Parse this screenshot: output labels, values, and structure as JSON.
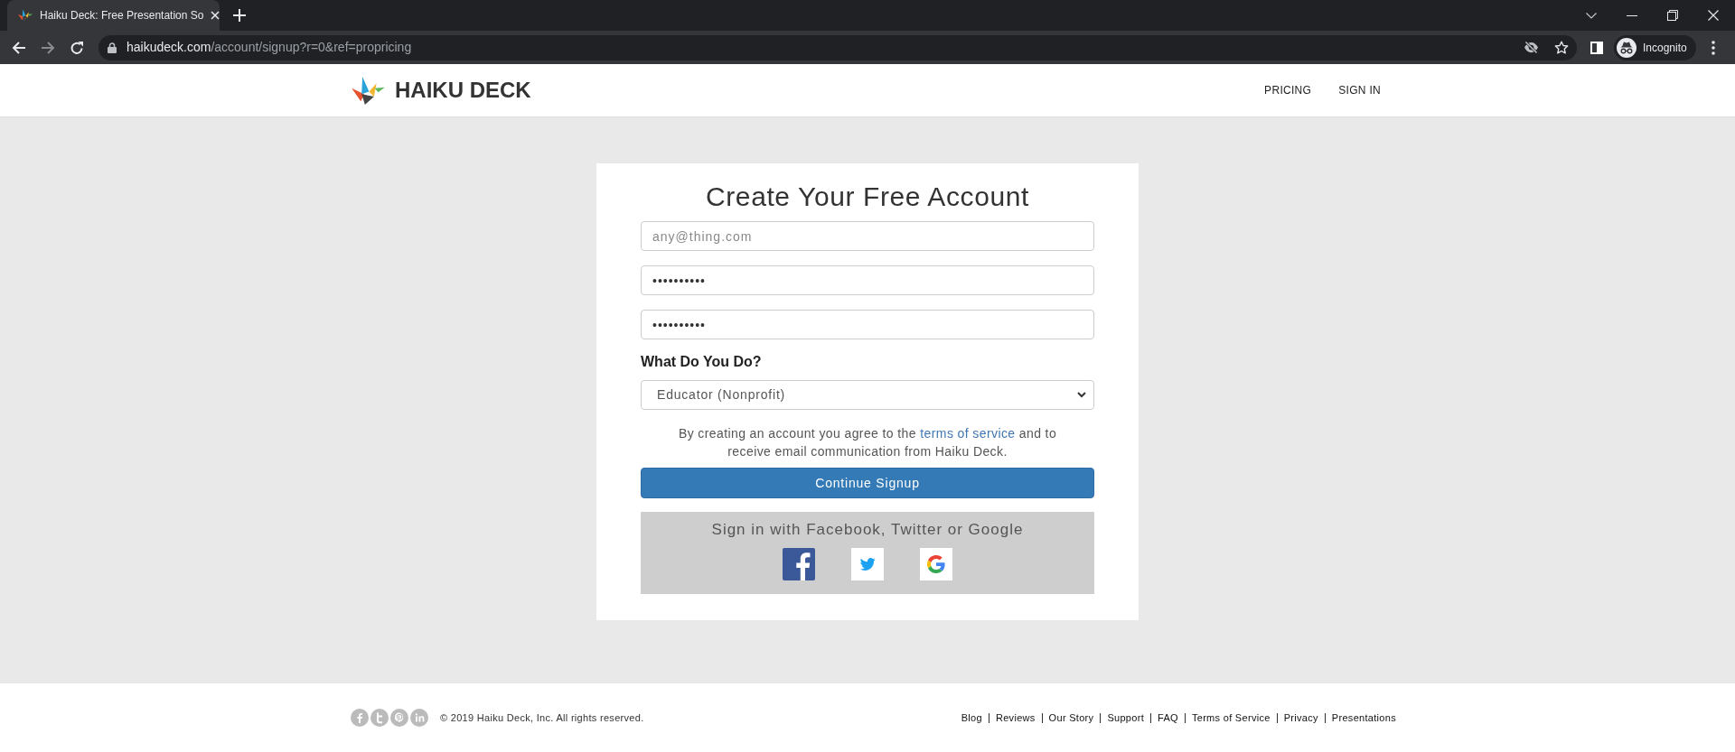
{
  "browser": {
    "tab_title": "Haiku Deck: Free Presentation So",
    "url": {
      "host": "haikudeck.com",
      "path": "/account/signup?r=0&ref=propricing"
    },
    "profile": "Incognito"
  },
  "header": {
    "logo": "HAIKU DECK",
    "nav": [
      {
        "label": "PRICING"
      },
      {
        "label": "SIGN IN"
      }
    ]
  },
  "signup": {
    "title": "Create Your Free Account",
    "fields": [
      {
        "placeholder": "any@thing.com"
      },
      {
        "value": "••••••••••"
      },
      {
        "value": "••••••••••"
      }
    ],
    "role": {
      "label": "What Do You Do?",
      "value": "Educator (Nonprofit)"
    },
    "consent": {
      "before": "By creating an account you agree to the ",
      "link": "terms of service",
      "after": " and to receive email communication from Haiku Deck."
    },
    "submit": "Continue Signup",
    "social": {
      "title": "Sign in with Facebook, Twitter or Google",
      "providers": [
        {
          "kind": "facebook"
        },
        {
          "kind": "twitter"
        },
        {
          "kind": "google"
        }
      ]
    }
  },
  "footer": {
    "social": [
      {
        "kind": "facebook"
      },
      {
        "kind": "twitter"
      },
      {
        "kind": "pinterest"
      },
      {
        "kind": "linkedin"
      }
    ],
    "copyright": "© 2019 Haiku Deck, Inc. All rights reserved.",
    "links": [
      "Blog",
      "Reviews",
      "Our Story",
      "Support",
      "FAQ",
      "Terms of Service",
      "Privacy",
      "Presentations"
    ]
  }
}
